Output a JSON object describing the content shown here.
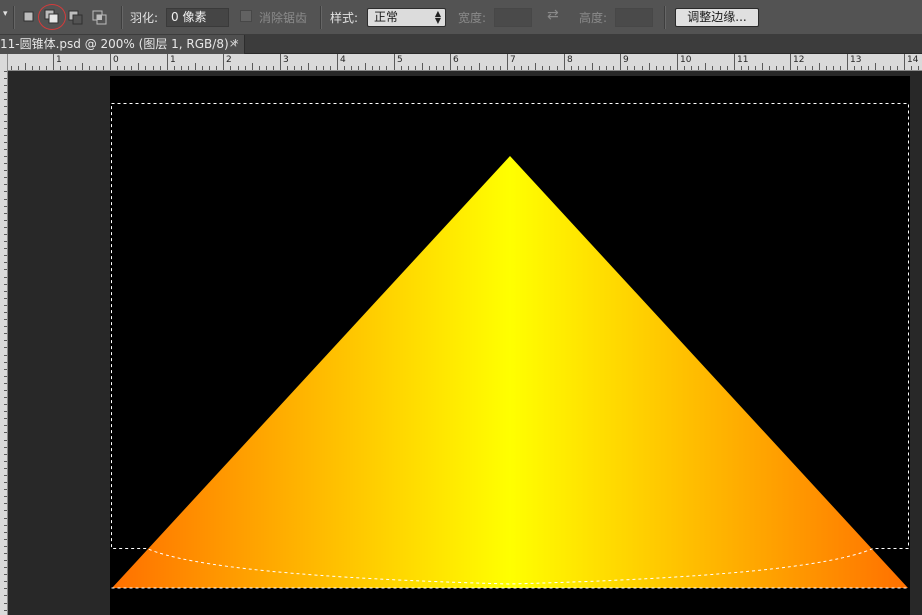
{
  "options_bar": {
    "selection_modes": [
      {
        "name": "new-selection-icon",
        "active": false
      },
      {
        "name": "add-to-selection-icon",
        "active": true
      },
      {
        "name": "subtract-from-selection-icon",
        "active": false
      },
      {
        "name": "intersect-selection-icon",
        "active": false
      }
    ],
    "feather_label": "羽化:",
    "feather_value": "0 像素",
    "antialias_label": "消除锯齿",
    "style_label": "样式:",
    "style_value": "正常",
    "width_label": "宽度:",
    "height_label": "高度:",
    "refine_edge_label": "调整边缘..."
  },
  "document_tab": {
    "title": "11-圆锥体.psd @ 200% (图层 1, RGB/8) *",
    "close": "×"
  },
  "ruler": {
    "horizontal_labels": [
      "1",
      "0",
      "1",
      "2",
      "3",
      "4",
      "5",
      "6",
      "7",
      "8",
      "9",
      "10",
      "11",
      "12",
      "13",
      "14"
    ]
  },
  "colors": {
    "cone_edge": "#ff7000",
    "cone_center": "#ffff00",
    "canvas": "#000000",
    "active_mode_ring": "#d43b3b"
  }
}
